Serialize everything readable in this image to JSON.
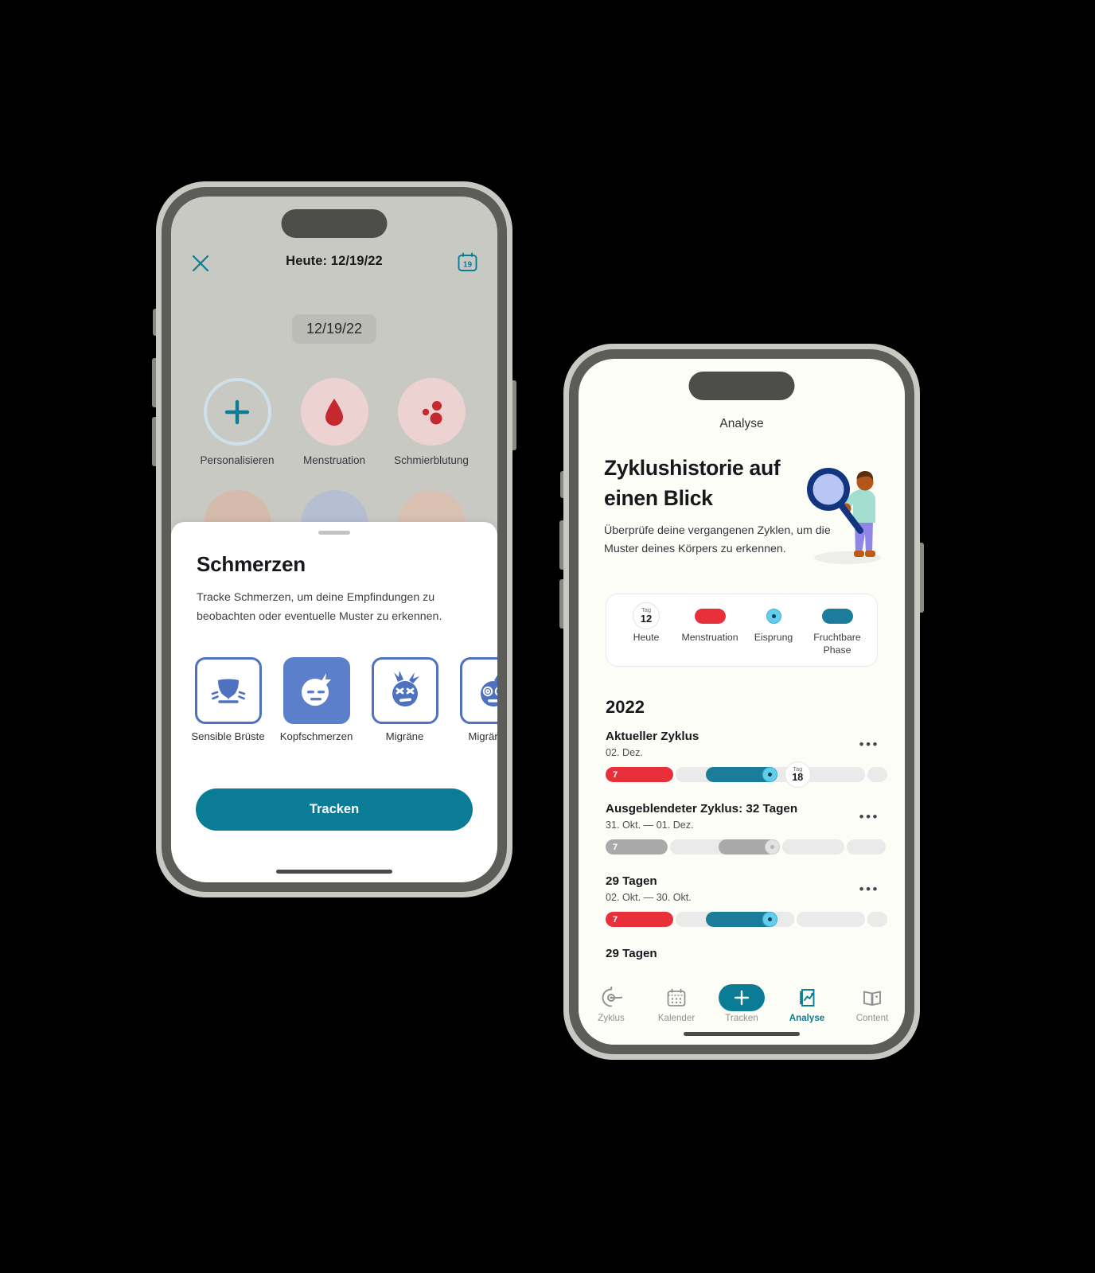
{
  "colors": {
    "teal": "#0b7c96",
    "menstruation_red": "#e8303a",
    "ovulation_blue": "#63cdec",
    "fertile_teal": "#1b7c9b",
    "symptom_blue": "#5b7fcb",
    "inactive_gray": "#a9a9a9"
  },
  "left_phone": {
    "topbar": {
      "close_icon": "close-icon",
      "title": "Heute: 12/19/22",
      "calendar_icon": "calendar-icon",
      "calendar_day": "19"
    },
    "date_chip": "12/19/22",
    "symptoms": [
      {
        "label": "Personalisieren",
        "icon": "plus-icon",
        "circle": "#cfe0ea",
        "style": "outline"
      },
      {
        "label": "Menstruation",
        "icon": "blood-drop-icon",
        "circle": "#ecd2d1",
        "style": "fill"
      },
      {
        "label": "Schmierblutung",
        "icon": "blood-spots-icon",
        "circle": "#ecd2d1",
        "style": "fill"
      },
      {
        "label": "",
        "icon": "face-icon",
        "circle": "#d5bbac",
        "style": "fill"
      },
      {
        "label": "",
        "icon": "pill-icon",
        "circle": "#b6bfd2",
        "style": "fill"
      },
      {
        "label": "",
        "icon": "face-icon-2",
        "circle": "#d9c0b1",
        "style": "fill"
      }
    ],
    "sheet": {
      "title": "Schmerzen",
      "description": "Tracke Schmerzen, um deine Empfindungen zu beobachten oder eventuelle Muster zu erkennen.",
      "chips": [
        {
          "label": "Sensible Brüste",
          "icon": "sore-breasts-icon",
          "selected": false
        },
        {
          "label": "Kopfschmerzen",
          "icon": "headache-face-icon",
          "selected": true
        },
        {
          "label": "Migräne",
          "icon": "migraine-face-icon",
          "selected": false
        },
        {
          "label": "Migräne m",
          "icon": "migraine-aura-face-icon",
          "selected": false
        }
      ],
      "button": "Tracken"
    }
  },
  "right_phone": {
    "header_title": "Analyse",
    "hero": {
      "heading": "Zyklushistorie auf einen Blick",
      "paragraph": "Überprüfe deine vergangenen Zyklen, um die Muster deines Körpers zu erkennen.",
      "illustration": "person-with-magnifier-illustration"
    },
    "legend": [
      {
        "label": "Heute",
        "type": "day-bubble",
        "day_prefix": "Tag",
        "day_number": "12"
      },
      {
        "label": "Menstruation",
        "type": "pill",
        "color": "#e8303a"
      },
      {
        "label": "Eisprung",
        "type": "dot",
        "color": "#63cdec"
      },
      {
        "label": "Fruchtbare Phase",
        "type": "pill",
        "color": "#1b7c9b"
      }
    ],
    "year": "2022",
    "cycles": [
      {
        "name": "Aktueller Zyklus",
        "date_range": "02. Dez.",
        "menses_days": "7",
        "muted": false,
        "today": {
          "prefix": "Tag",
          "number": "18"
        },
        "menu_icon": "more-options-icon"
      },
      {
        "name": "Ausgeblendeter Zyklus: 32 Tagen",
        "date_range": "31. Okt. — 01. Dez.",
        "menses_days": "7",
        "muted": true,
        "today": null,
        "menu_icon": "more-options-icon"
      },
      {
        "name": "29 Tagen",
        "date_range": "02. Okt. — 30. Okt.",
        "menses_days": "7",
        "muted": false,
        "today": null,
        "menu_icon": "more-options-icon"
      },
      {
        "name": "29 Tagen",
        "date_range": "",
        "menses_days": "",
        "muted": false,
        "today": null,
        "menu_icon": ""
      }
    ],
    "tabs": [
      {
        "label": "Zyklus",
        "icon": "cycle-icon",
        "active": false
      },
      {
        "label": "Kalender",
        "icon": "calendar-icon",
        "active": false
      },
      {
        "label": "Tracken",
        "icon": "plus-icon",
        "active": false,
        "fab": true
      },
      {
        "label": "Analyse",
        "icon": "analysis-chart-icon",
        "active": true
      },
      {
        "label": "Content",
        "icon": "book-icon",
        "active": false
      }
    ]
  }
}
